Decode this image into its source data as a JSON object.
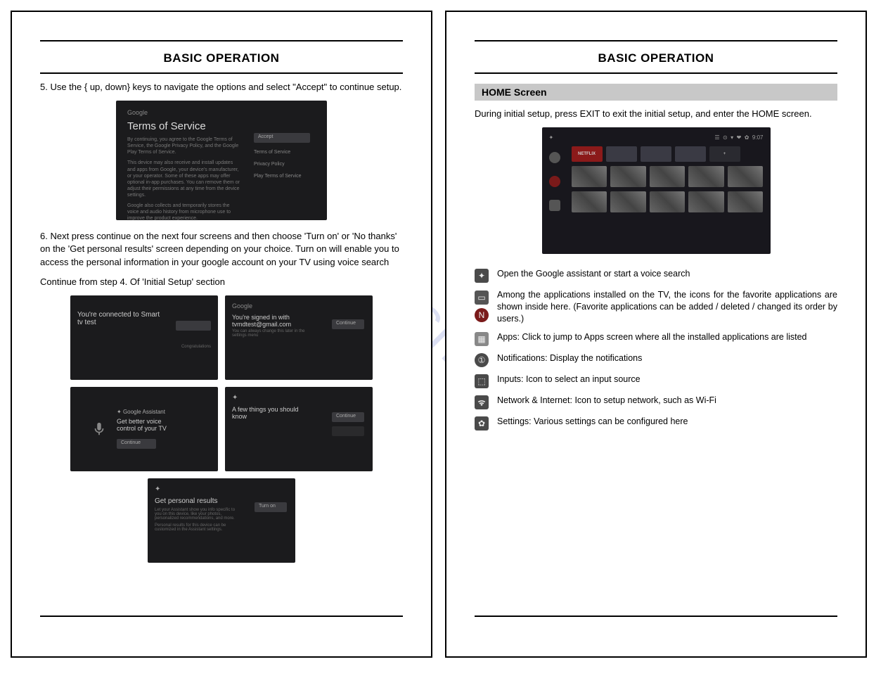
{
  "watermark": "manualshive.com",
  "left_page": {
    "title": "BASIC OPERATION",
    "step5": "5. Use the { up, down} keys to navigate the options and select \"Accept\" to continue setup.",
    "tos_shot": {
      "brand": "Google",
      "heading": "Terms of Service",
      "line1": "By continuing, you agree to the Google Terms of Service, the Google Privacy Policy, and the Google Play Terms of Service.",
      "line2": "This device may also receive and install updates and apps from Google, your device's manufacturer, or your operator. Some of these apps may offer optional in-app purchases. You can remove them or adjust their permissions at any time from the device settings.",
      "line3": "Google also collects and temporarily stores the voice and audio history from microphone use to improve the product experience.",
      "btn_accept": "Accept",
      "opt_terms": "Terms of Service",
      "opt_privacy": "Privacy Policy",
      "opt_play": "Play Terms of Service"
    },
    "step6": "6. Next press continue on the next four screens and then choose 'Turn on' or 'No thanks' on the 'Get personal results' screen depending on your choice. Turn on will enable you to access the personal information in your google account on your TV using voice search",
    "continue_note": "Continue from step 4.  Of 'Initial Setup' section",
    "shotA": {
      "line1": "You're connected to Smart",
      "line2": "tv test",
      "sub": "Congratulations"
    },
    "shotB": {
      "brand": "Google",
      "line1": "You're signed in with",
      "line2": "tvmdtest@gmail.com",
      "sub": "You can always change this later in the settings menu",
      "btn": "Continue"
    },
    "shotC": {
      "brand": "Google Assistant",
      "line1": "Get better voice",
      "line2": "control of your TV",
      "btn": "Continue"
    },
    "shotD": {
      "line1": "A few things you should",
      "line2": "know",
      "btn": "Continue"
    },
    "shotE": {
      "heading": "Get personal results",
      "sub1": "Let your Assistant show you info specific to you on this device, like your photos, personalized recommendations, and more.",
      "sub2": "Personal results for this device can be customized in the Assistant settings.",
      "btn": "Turn on"
    }
  },
  "right_page": {
    "title": "BASIC OPERATION",
    "section": "HOME Screen",
    "intro": "During initial setup, press EXIT to exit the initial setup, and enter the HOME screen.",
    "home_shot": {
      "time": "9:07",
      "netflix": "NETFLIX"
    },
    "icons": {
      "assistant": "Open the Google assistant or start a voice search",
      "favorites": "Among the applications installed on the TV, the icons for the favorite applications are  shown inside here. (Favorite applications can be added / deleted / changed its order by users.)",
      "apps": "Apps: Click to jump to Apps screen where all the installed applications are listed",
      "notifications": "Notifications: Display the notifications",
      "inputs": "Inputs: Icon to select an input source",
      "network": "Network & Internet: Icon to setup network, such as Wi-Fi",
      "settings": "Settings: Various settings can be configured here"
    }
  }
}
